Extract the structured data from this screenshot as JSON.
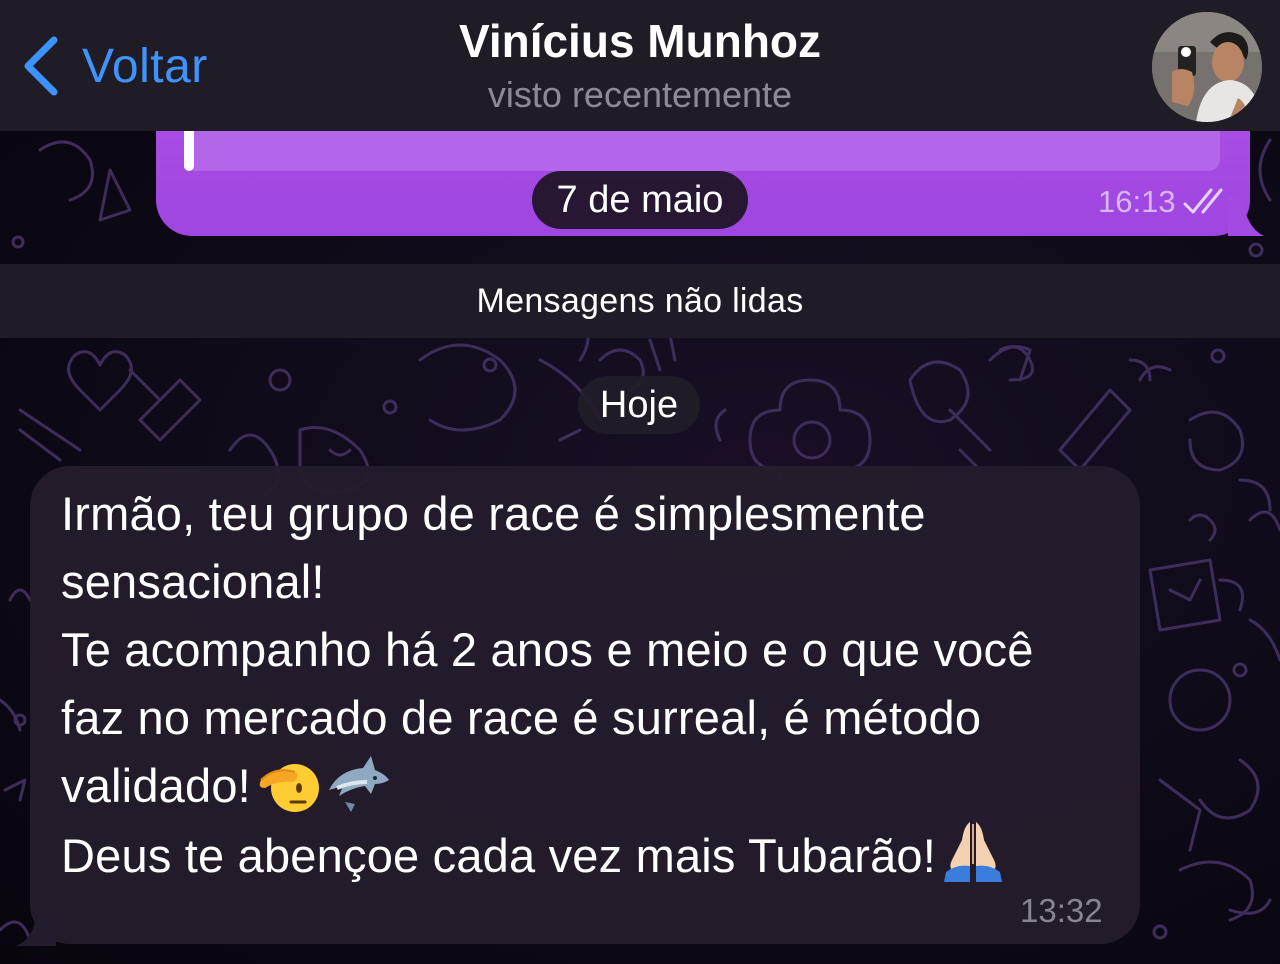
{
  "header": {
    "back_label": "Voltar",
    "contact_name": "Vinícius Munhoz",
    "contact_status": "visto recentemente"
  },
  "outgoing_message": {
    "time": "16:13",
    "status": "read"
  },
  "date_separators": {
    "previous": "7 de maio",
    "today": "Hoje"
  },
  "unread_divider": "Mensagens não lidas",
  "incoming_message": {
    "lines": [
      "Irmão, teu grupo de race é simplesmente",
      "sensacional!",
      "Te acompanho há 2 anos e meio e o que você",
      "faz no mercado de race é surreal, é método",
      "validado!",
      "Deus te abençoe cada vez mais Tubarão!"
    ],
    "emojis": [
      "saluting-face",
      "shark",
      "folded-hands"
    ],
    "time": "13:32"
  },
  "colors": {
    "accent": "#3f93ff",
    "outgoing_bubble": "#a94fe6",
    "incoming_bubble": "#241c2c",
    "header_bg": "#201c26"
  }
}
